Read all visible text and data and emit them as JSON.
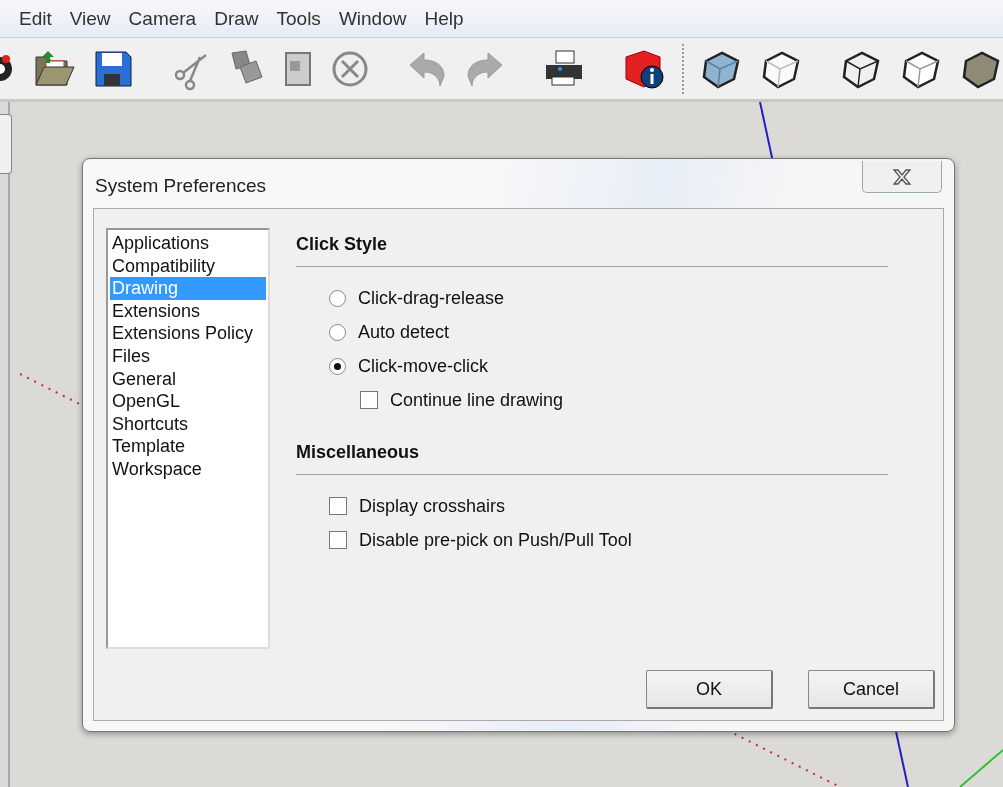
{
  "menu": [
    {
      "label": "Edit"
    },
    {
      "label": "View"
    },
    {
      "label": "Camera"
    },
    {
      "label": "Draw"
    },
    {
      "label": "Tools"
    },
    {
      "label": "Window"
    },
    {
      "label": "Help"
    }
  ],
  "dialog": {
    "title": "System Preferences",
    "categories": [
      {
        "label": "Applications",
        "selected": false
      },
      {
        "label": "Compatibility",
        "selected": false
      },
      {
        "label": "Drawing",
        "selected": true
      },
      {
        "label": "Extensions",
        "selected": false
      },
      {
        "label": "Extensions Policy",
        "selected": false
      },
      {
        "label": "Files",
        "selected": false
      },
      {
        "label": "General",
        "selected": false
      },
      {
        "label": "OpenGL",
        "selected": false
      },
      {
        "label": "Shortcuts",
        "selected": false
      },
      {
        "label": "Template",
        "selected": false
      },
      {
        "label": "Workspace",
        "selected": false
      }
    ],
    "sections": [
      {
        "title": "Click Style",
        "options": [
          {
            "kind": "radio",
            "label": "Click-drag-release",
            "selected": false
          },
          {
            "kind": "radio",
            "label": "Auto detect",
            "selected": false
          },
          {
            "kind": "radio",
            "label": "Click-move-click",
            "selected": true,
            "children": [
              {
                "kind": "checkbox",
                "label": "Continue line drawing",
                "checked": false
              }
            ]
          }
        ]
      },
      {
        "title": "Miscellaneous",
        "options": [
          {
            "kind": "checkbox",
            "label": "Display crosshairs",
            "checked": false
          },
          {
            "kind": "checkbox",
            "label": "Disable pre-pick on Push/Pull Tool",
            "checked": false
          }
        ]
      }
    ],
    "buttons": [
      {
        "label": "OK"
      },
      {
        "label": "Cancel"
      }
    ]
  }
}
